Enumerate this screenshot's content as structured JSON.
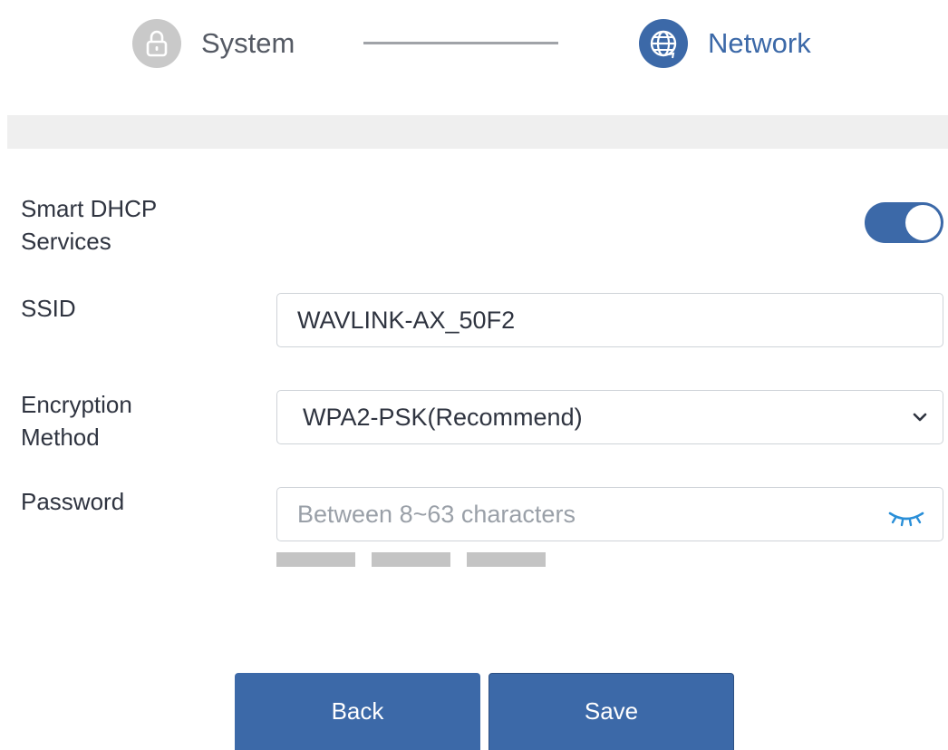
{
  "stepper": {
    "steps": [
      {
        "label": "System",
        "icon": "lock-icon",
        "state": "completed"
      },
      {
        "label": "Network",
        "icon": "globe-icon",
        "state": "active"
      }
    ]
  },
  "form": {
    "dhcp": {
      "label_line1": "Smart DHCP",
      "label_line2": "Services",
      "enabled": true
    },
    "ssid": {
      "label": "SSID",
      "value": "WAVLINK-AX_50F2"
    },
    "encryption": {
      "label_line1": "Encryption",
      "label_line2": "Method",
      "selected": "WPA2-PSK(Recommend)"
    },
    "password": {
      "label": "Password",
      "value": "",
      "placeholder": "Between 8~63 characters",
      "strength_segments": 3
    }
  },
  "buttons": {
    "back": "Back",
    "save": "Save"
  },
  "colors": {
    "accent": "#3c69a8",
    "inactive_step": "#c9c9c9",
    "strength_bar": "#c4c4c4",
    "band": "#efefef"
  }
}
